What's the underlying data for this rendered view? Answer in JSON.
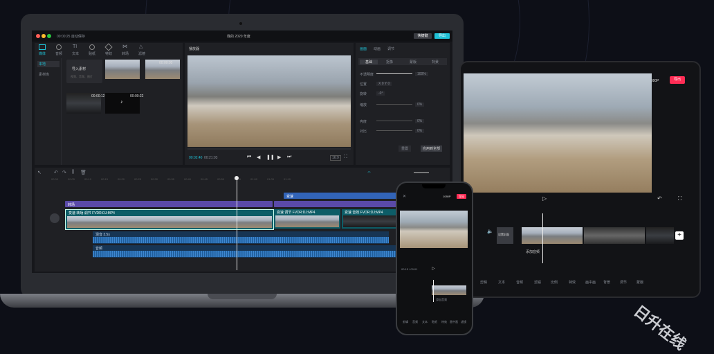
{
  "laptop": {
    "title": "我的 2020 年度",
    "top_left": "00:00:25 自动保存",
    "export_label": "导出",
    "shortcut_label": "快捷键",
    "toolbar": [
      "媒体",
      "音频",
      "文本",
      "贴纸",
      "特效",
      "转场",
      "滤镜"
    ],
    "media_side": [
      "本地",
      "素材库"
    ],
    "import_label": "导入素材",
    "import_sub": "视频、音频、图片",
    "clip_names": [
      "00:00:05",
      "00:00:12",
      "00:00:22"
    ],
    "player_label": "播放器",
    "time_current": "00:02:40",
    "time_total": "00:21:03",
    "ratio": "16:9",
    "props_tabs": [
      "画面",
      "动画",
      "调节"
    ],
    "props_sub": [
      "基础",
      "抠像",
      "蒙版",
      "背景"
    ],
    "props": [
      {
        "label": "不透明度",
        "value": "100%"
      },
      {
        "label": "位置",
        "value": "X 0    Y 0"
      },
      {
        "label": "旋转",
        "value": "-0°"
      },
      {
        "label": "缩放",
        "value": "0%"
      },
      {
        "label": "亮度",
        "value": "0%"
      },
      {
        "label": "对比",
        "value": "0%"
      }
    ],
    "reset_label": "重置",
    "apply_all_label": "应用到全部",
    "timeline_ticks": [
      "00:00",
      "00:05",
      "00:10",
      "00:15",
      "00:20",
      "00:25",
      "00:30",
      "00:35",
      "00:40",
      "00:45",
      "00:50",
      "00:55",
      "01:00",
      "01:05",
      "01:10"
    ],
    "track_labels": [
      "变速",
      "转场",
      "变速 转场 调节 FVDR:DJ:MP4",
      "变速 调节 FVDR:DJ:MP4",
      "变速 音效 FVDR:DJ:MP4"
    ],
    "audio_labels": [
      "混音 3.5s",
      "音频"
    ]
  },
  "tablet": {
    "export_label": "导出",
    "resolution": "1080P",
    "add_audio": "添加音频",
    "cover_label": "设置封面",
    "tools": [
      "剪辑",
      "文本",
      "音频",
      "滤镜",
      "比例",
      "特效",
      "画中画",
      "背景",
      "调节",
      "蒙版"
    ]
  },
  "phone": {
    "export_label": "导出",
    "resolution": "1080P",
    "time": "00:15 / 00:01",
    "tools": [
      "剪辑",
      "音频",
      "文本",
      "贴纸",
      "特效",
      "画中画",
      "滤镜"
    ],
    "add_audio": "添加音频"
  },
  "watermark": "日升在线",
  "colors": {
    "accent": "#1fc1d6",
    "brand_red": "#ff2d55",
    "video_track": "#0d5d67",
    "purple_track": "#5a4aa8",
    "blue_track": "#3264b8"
  }
}
